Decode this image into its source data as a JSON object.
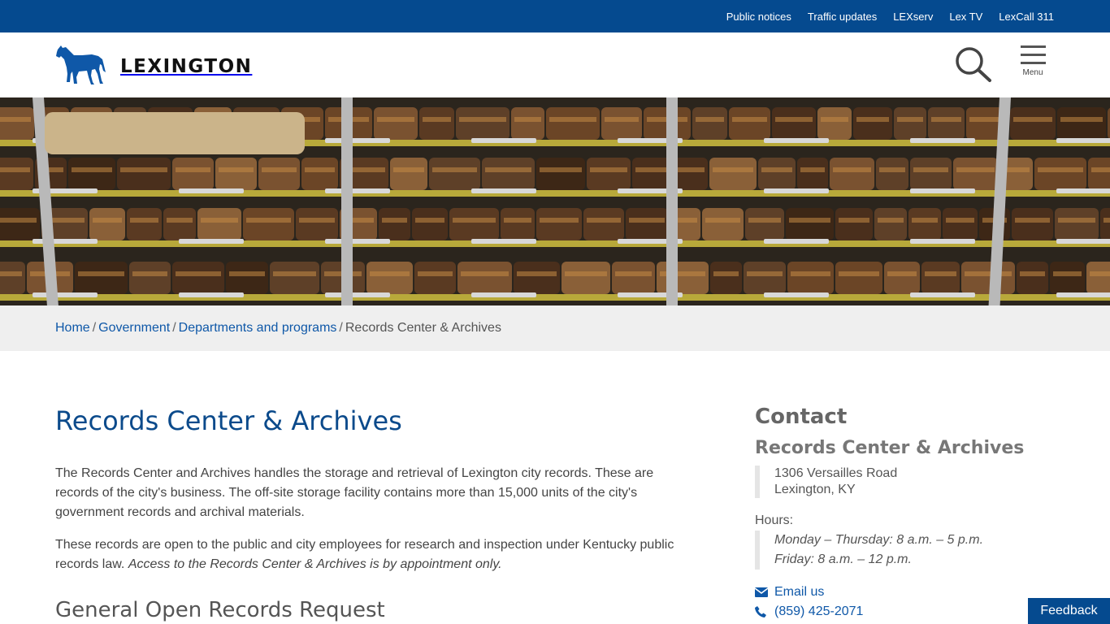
{
  "utility_nav": {
    "links": [
      "Public notices",
      "Traffic updates",
      "LEXserv",
      "Lex TV",
      "LexCall 311"
    ]
  },
  "header": {
    "logo_text": "LEXINGTON",
    "menu_label": "Menu",
    "brand_color": "#054a8f"
  },
  "breadcrumb": {
    "home": "Home",
    "government": "Government",
    "departments": "Departments and programs",
    "current": "Records Center & Archives",
    "separator": "/"
  },
  "main": {
    "title": "Records Center & Archives",
    "intro": "The Records Center and Archives handles the storage and retrieval of Lexington city records. These are records of the city's business. The off-site storage facility contains more than 15,000 units of the city's government records and archival materials.",
    "para2_text": "These records are open to the public and city employees for research and inspection under Kentucky public records law.",
    "para2_italic": "Access to the Records Center & Archives is by appointment only.",
    "section_title": "General Open Records Request"
  },
  "sidebar": {
    "heading": "Contact",
    "org": "Records Center & Archives",
    "address_line1": "1306 Versailles Road",
    "address_line2": "Lexington, KY",
    "hours_label": "Hours:",
    "hours_line1": "Monday – Thursday: 8 a.m. – 5 p.m.",
    "hours_line2": "Friday: 8 a.m. – 12 p.m.",
    "email_label": "Email us",
    "phone": "(859) 425-2071"
  },
  "feedback": {
    "label": "Feedback"
  }
}
